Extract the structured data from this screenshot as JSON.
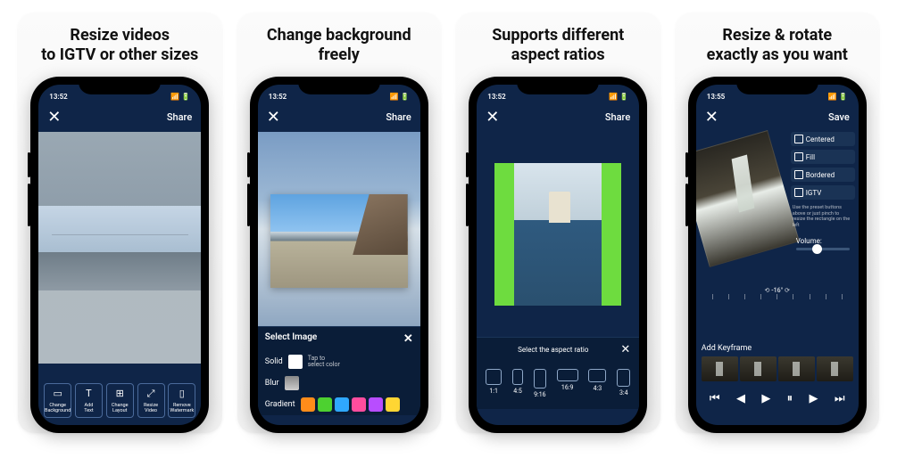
{
  "cards": [
    {
      "caption": "Resize videos\nto IGTV or other sizes"
    },
    {
      "caption": "Change background\nfreely"
    },
    {
      "caption": "Supports different\naspect ratios"
    },
    {
      "caption": "Resize & rotate\nexactly as you want"
    }
  ],
  "status_time": "13:52",
  "status_time4": "13:55",
  "header": {
    "close": "✕",
    "share": "Share",
    "save": "Save"
  },
  "bottom_buttons": [
    {
      "label": "Change\nBackground",
      "icon": "▭"
    },
    {
      "label": "Add\nText",
      "icon": "T"
    },
    {
      "label": "Change\nLayout",
      "icon": "⊞"
    },
    {
      "label": "Resize\nVideo",
      "icon": "⤢"
    },
    {
      "label": "Remove\nWatermark",
      "icon": "▯"
    }
  ],
  "bg_panel": {
    "title": "Select Image",
    "solid": "Solid",
    "blur": "Blur",
    "gradient": "Gradient",
    "hint": "Tap to\nselect color",
    "colors": [
      "#ff8c1a",
      "#4dd130",
      "#2fa8ff",
      "#ff4d9e",
      "#b84dff",
      "#ffd633"
    ]
  },
  "aspect": {
    "hint": "Select the aspect ratio",
    "ratios": [
      "1:1",
      "4:5",
      "9:16",
      "16:9",
      "4:3",
      "3:4"
    ]
  },
  "resize": {
    "presets": [
      "Centered",
      "Fill",
      "Bordered",
      "IGTV"
    ],
    "note": "Use the preset buttons above or just pinch to resize the rectangle on the left",
    "volume_label": "Volume:",
    "angle": "-16°",
    "keyframe": "Add Keyframe"
  },
  "play_icons": [
    "⏮",
    "◀",
    "▶",
    "⏸",
    "▶",
    "⏭"
  ]
}
